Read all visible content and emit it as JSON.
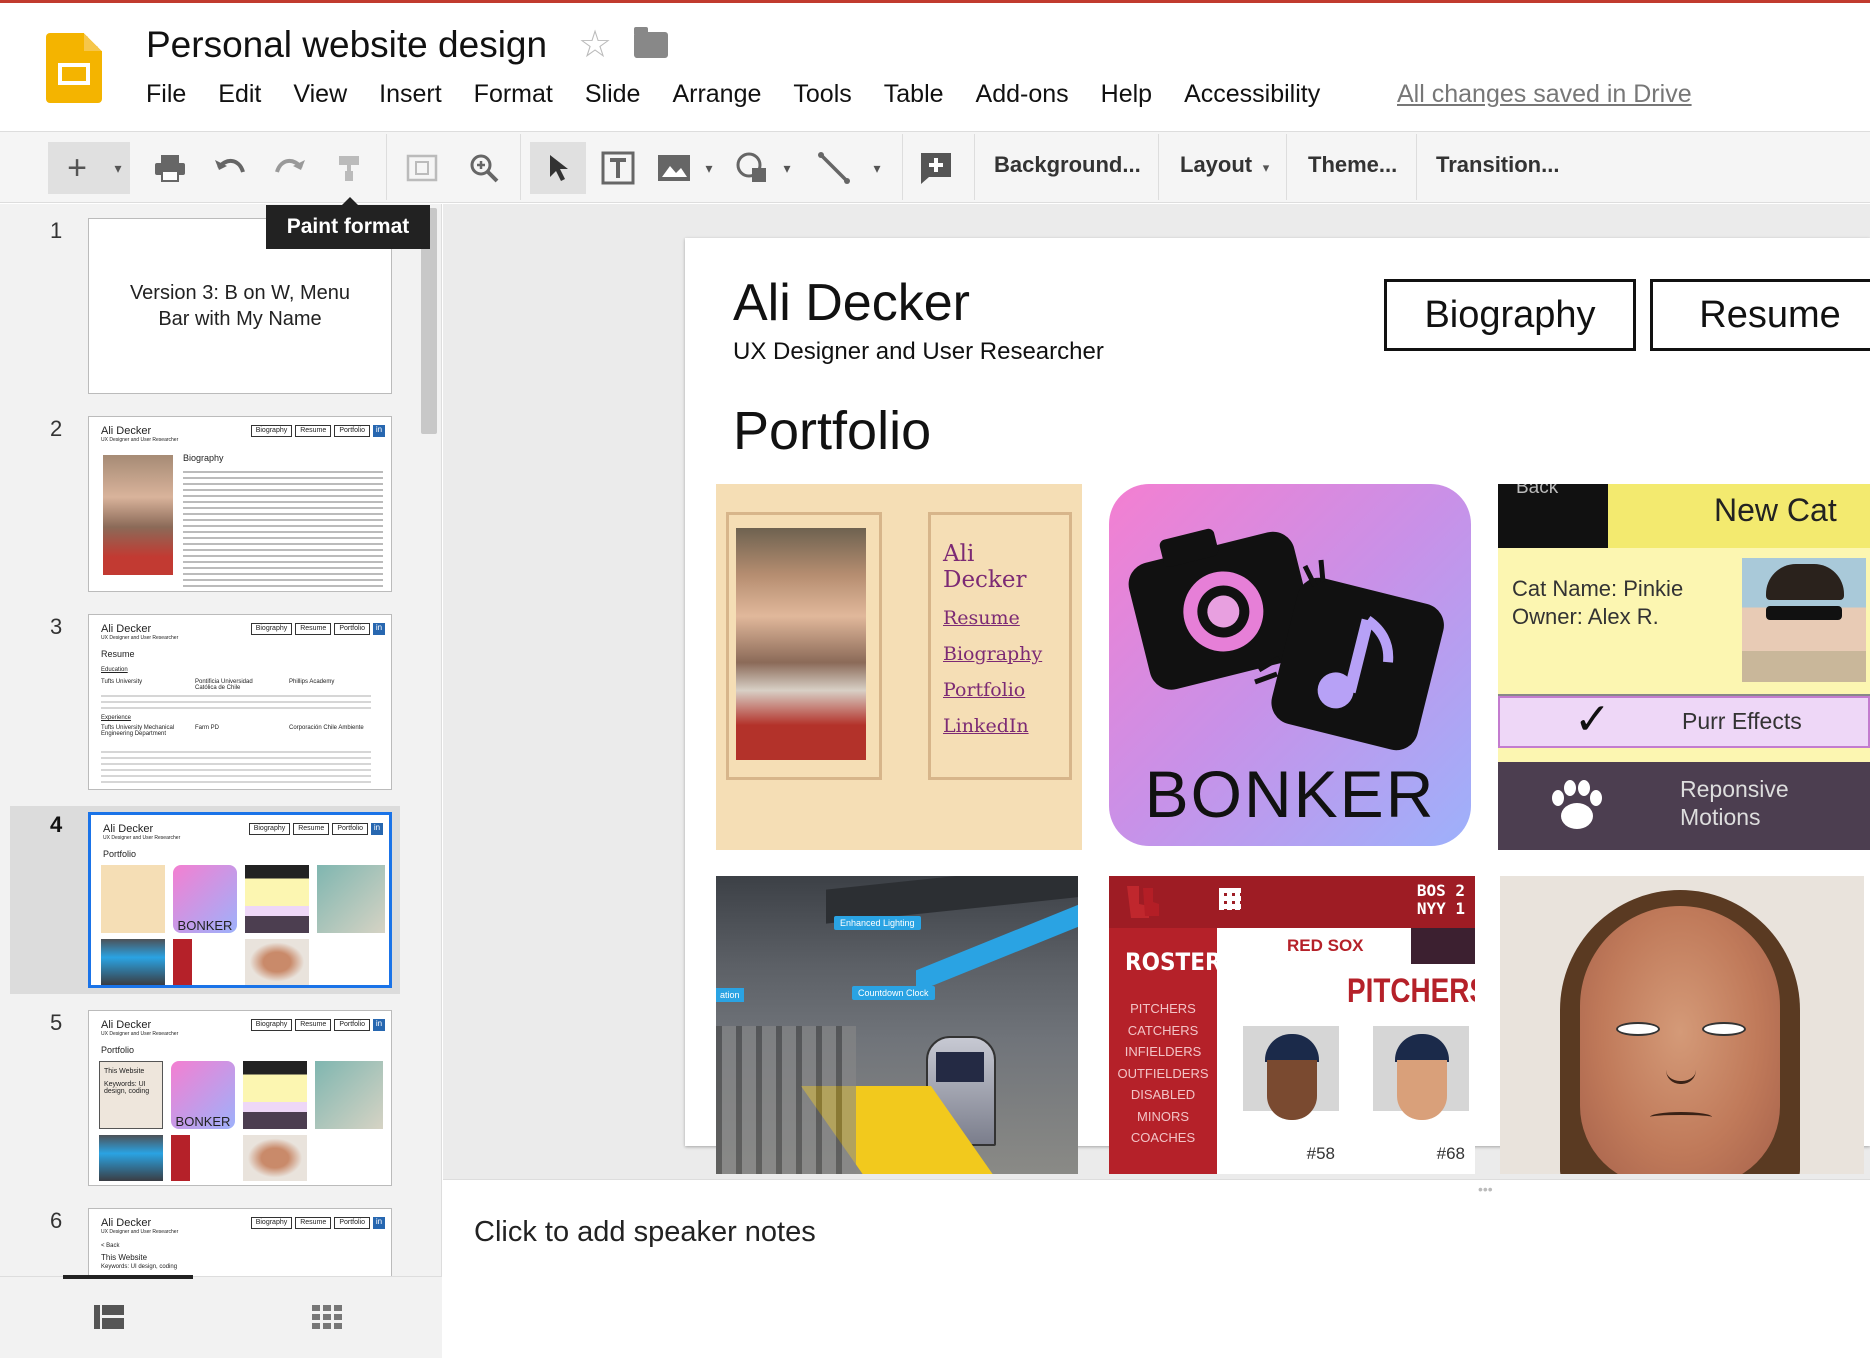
{
  "app": {
    "title": "Personal website design",
    "saved_status": "All changes saved in Drive"
  },
  "menu": [
    "File",
    "Edit",
    "View",
    "Insert",
    "Format",
    "Slide",
    "Arrange",
    "Tools",
    "Table",
    "Add-ons",
    "Help",
    "Accessibility"
  ],
  "toolbar": {
    "background": "Background...",
    "layout": "Layout",
    "theme": "Theme...",
    "transition": "Transition...",
    "tooltip": "Paint format"
  },
  "slides": [
    {
      "number": "1",
      "text": "Version 3: B on W, Menu Bar with My Name"
    },
    {
      "number": "2",
      "name": "Ali Decker",
      "sub": "UX Designer and User Researcher",
      "heading": "Biography"
    },
    {
      "number": "3",
      "name": "Ali Decker",
      "sub": "UX Designer and User Researcher",
      "heading": "Resume",
      "section1": "Education",
      "col1": "Tufts University",
      "col2": "Pontificia Universidad Católica de Chile",
      "col3": "Phillips Academy",
      "section2": "Experience",
      "exp1": "Tufts University Mechanical Engineering Department",
      "exp2": "Farm PD",
      "exp3": "Corporación Chile Ambiente"
    },
    {
      "number": "4",
      "name": "Ali Decker",
      "sub": "UX Designer and User Researcher",
      "heading": "Portfolio"
    },
    {
      "number": "5",
      "name": "Ali Decker",
      "sub": "UX Designer and User Researcher",
      "heading": "Portfolio",
      "overlay": "This Website",
      "keywords": "Keywords: UI design, coding"
    },
    {
      "number": "6",
      "name": "Ali Decker",
      "sub": "UX Designer and User Researcher",
      "back": "< Back",
      "heading": "This Website",
      "keywords": "Keywords: UI design, coding"
    }
  ],
  "mini_buttons": [
    "Biography",
    "Resume",
    "Portfolio"
  ],
  "mini_linkedin": "in",
  "main_slide": {
    "name": "Ali Decker",
    "subtitle": "UX Designer and User Researcher",
    "heading": "Portfolio",
    "buttons": [
      "Biography",
      "Resume"
    ],
    "tile1": {
      "name": "Ali Decker",
      "links": [
        "Resume",
        "Biography",
        "Portfolio",
        "LinkedIn"
      ]
    },
    "tile2": {
      "label": "BONKER"
    },
    "tile3": {
      "back": "Back",
      "title": "New Cat",
      "cat_name": "Cat Name: Pinkie",
      "owner": "Owner: Alex R.",
      "purr": "Purr Effects",
      "check": "✓",
      "motions": "Reponsive Motions"
    },
    "tile4": {
      "label1": "Enhanced Lighting",
      "label2": "Countdown Clock",
      "label3": "ation"
    },
    "tile5": {
      "score1": "BOS 2",
      "score2": "NYY 1",
      "roster": "ROSTER",
      "team": "RED SOX",
      "pitchers": "PITCHERS",
      "menu": [
        "PITCHERS",
        "CATCHERS",
        "INFIELDERS",
        "OUTFIELDERS",
        "DISABLED",
        "MINORS",
        "COACHES"
      ],
      "num1": "#58",
      "num2": "#68"
    }
  },
  "notes": "Click to add speaker notes",
  "colors": {
    "accent": "#f4b400",
    "selection": "#1a73e8",
    "bonker_start": "#f47fd1",
    "bonker_end": "#9db1fb"
  }
}
